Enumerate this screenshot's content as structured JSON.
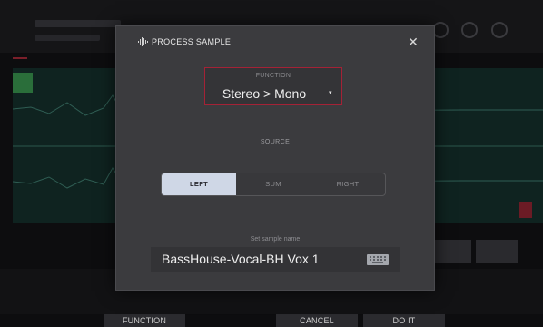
{
  "modal": {
    "title": "PROCESS SAMPLE",
    "close_icon": "close-icon",
    "header_icon": "waveform-icon",
    "function": {
      "label": "FUNCTION",
      "value": "Stereo > Mono",
      "caret": "▾"
    },
    "source": {
      "label": "SOURCE",
      "options": [
        "LEFT",
        "SUM",
        "RIGHT"
      ],
      "selected": "LEFT"
    },
    "sample_name": {
      "label": "Set sample name",
      "value": "BassHouse-Vocal-BH Vox 1",
      "keyboard_icon": "keyboard-icon"
    }
  },
  "softkeys": {
    "function": "FUNCTION",
    "cancel": "CANCEL",
    "do_it": "DO IT"
  },
  "colors": {
    "accent": "#a42236",
    "selected_segment": "#cfd7e6",
    "modal_bg": "#3b3b3e"
  }
}
